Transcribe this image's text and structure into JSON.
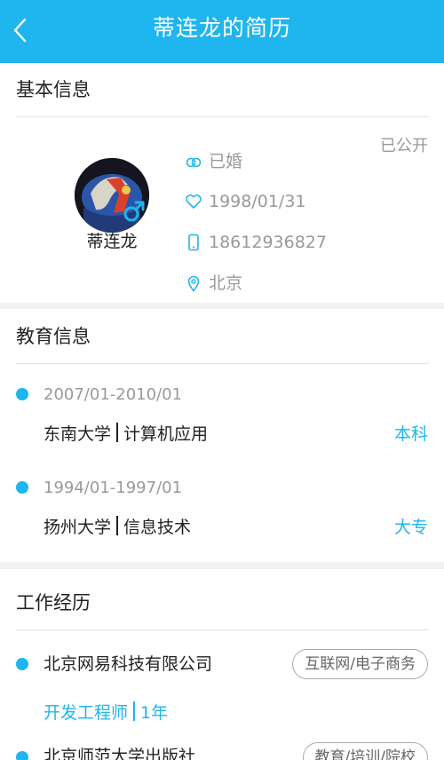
{
  "header": {
    "title": "蒂连龙的简历",
    "back_icon": "chevron-left-icon"
  },
  "colors": {
    "accent": "#1fb5ee",
    "muted": "#999999"
  },
  "basic": {
    "section_title": "基本信息",
    "public_status": "已公开",
    "name": "蒂连龙",
    "gender_icon": "male-icon",
    "marital": "已婚",
    "birthday": "1998/01/31",
    "phone": "18612936827",
    "city": "北京"
  },
  "education": {
    "section_title": "教育信息",
    "items": [
      {
        "period": "2007/01-2010/01",
        "school": "东南大学",
        "major": "计算机应用",
        "degree": "本科"
      },
      {
        "period": "1994/01-1997/01",
        "school": "扬州大学",
        "major": "信息技术",
        "degree": "大专"
      }
    ]
  },
  "work": {
    "section_title": "工作经历",
    "items": [
      {
        "company": "北京网易科技有限公司",
        "industry": "互联网/电子商务",
        "position": "开发工程师",
        "duration": "1年"
      },
      {
        "company": "北京师范大学出版社",
        "industry": "教育/培训/院校"
      }
    ]
  }
}
